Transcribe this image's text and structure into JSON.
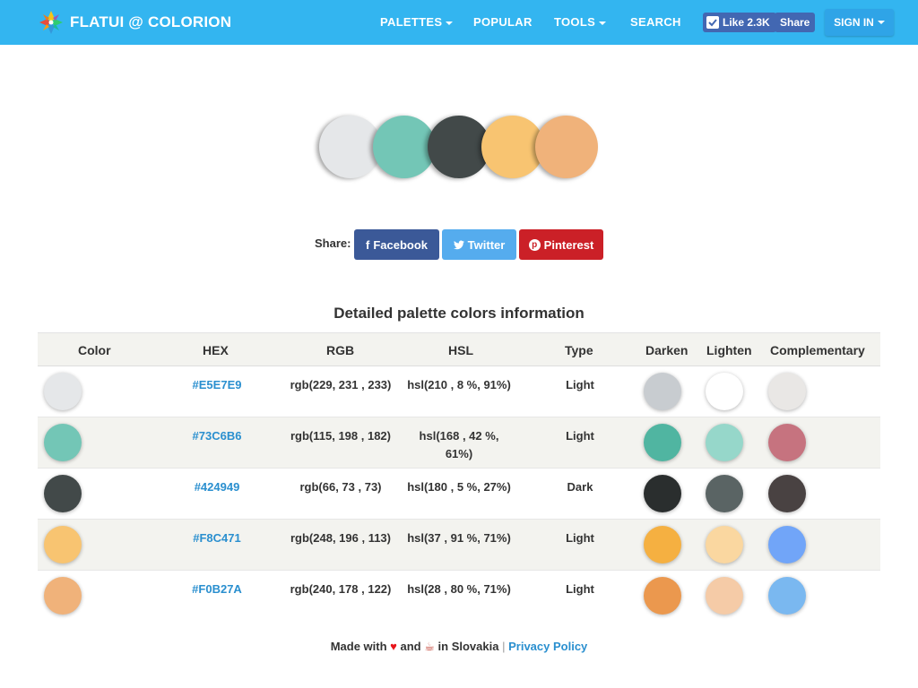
{
  "navbar": {
    "brand": "FLATUI @ COLORION",
    "items": [
      {
        "label": "PALETTES",
        "dropdown": true
      },
      {
        "label": "POPULAR",
        "dropdown": false
      },
      {
        "label": "TOOLS",
        "dropdown": true
      },
      {
        "label": "SEARCH",
        "dropdown": false
      }
    ],
    "like_label": "Like 2.3K",
    "share_label": "Share",
    "signin_label": "SIGN IN"
  },
  "palette": [
    "#E5E7E9",
    "#73C6B6",
    "#424949",
    "#F8C471",
    "#F0B27A"
  ],
  "share": {
    "label": "Share:",
    "facebook": "Facebook",
    "twitter": "Twitter",
    "pinterest": "Pinterest"
  },
  "table": {
    "title": "Detailed palette colors information",
    "headers": [
      "Color",
      "HEX",
      "RGB",
      "HSL",
      "Type",
      "Darken",
      "Lighten",
      "Complementary"
    ],
    "rows": [
      {
        "color": "#E5E7E9",
        "hex": "#E5E7E9",
        "rgb": "rgb(229, 231 , 233)",
        "hsl": "hsl(210 , 8 %, 91%)",
        "type": "Light",
        "darken": "#c8ccd0",
        "lighten": "#ffffff",
        "complementary": "#e9e7e5"
      },
      {
        "color": "#73C6B6",
        "hex": "#73C6B6",
        "rgb": "rgb(115, 198 , 182)",
        "hsl": "hsl(168 , 42 %, 61%)",
        "type": "Light",
        "darken": "#50b5a1",
        "lighten": "#96d7ca",
        "complementary": "#c6737f"
      },
      {
        "color": "#424949",
        "hex": "#424949",
        "rgb": "rgb(66, 73 , 73)",
        "hsl": "hsl(180 , 5 %, 27%)",
        "type": "Dark",
        "darken": "#2a2e2e",
        "lighten": "#5a6464",
        "complementary": "#494242"
      },
      {
        "color": "#F8C471",
        "hex": "#F8C471",
        "rgb": "rgb(248, 196 , 113)",
        "hsl": "hsl(37 , 91 %, 71%)",
        "type": "Light",
        "darken": "#f5b041",
        "lighten": "#fad7a0",
        "complementary": "#71a5f8"
      },
      {
        "color": "#F0B27A",
        "hex": "#F0B27A",
        "rgb": "rgb(240, 178 , 122)",
        "hsl": "hsl(28 , 80 %, 71%)",
        "type": "Light",
        "darken": "#eb984e",
        "lighten": "#f5cba7",
        "complementary": "#7ab8f0"
      }
    ]
  },
  "footer": {
    "made_with": "Made with",
    "and": "and",
    "in": "in Slovakia",
    "separator": "|",
    "privacy": "Privacy Policy"
  },
  "colors": {
    "navbar": "#33b5f0",
    "link": "#2a8fcf",
    "facebook": "#3b5998",
    "twitter": "#55acee",
    "pinterest": "#cb2027"
  }
}
